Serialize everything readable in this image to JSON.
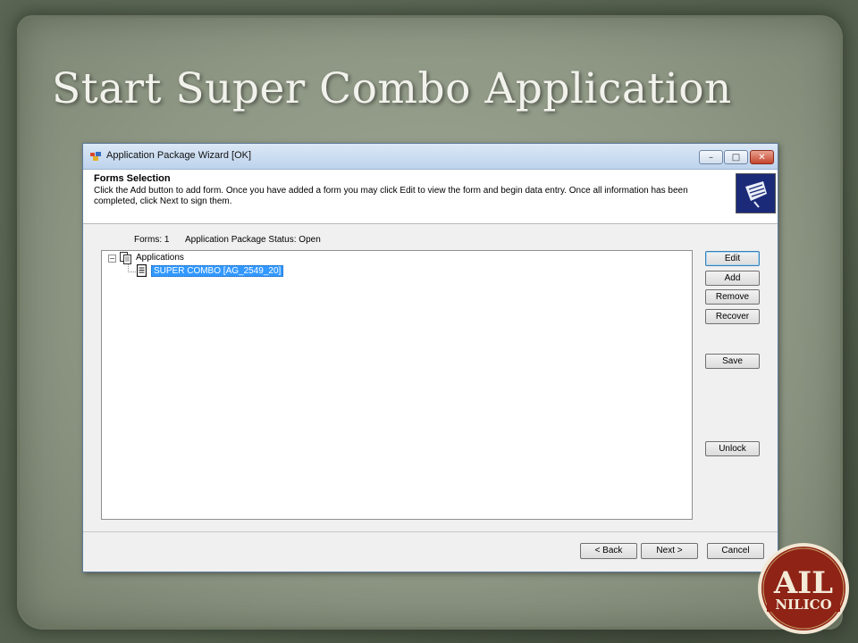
{
  "slide": {
    "title": "Start Super Combo Application",
    "logo_text": "NILICO",
    "logo_monogram": "AIL"
  },
  "window": {
    "title": "Application Package Wizard [OK]",
    "controls": {
      "minimize": "–",
      "maximize": "□",
      "close": "✕"
    }
  },
  "header": {
    "title": "Forms Selection",
    "description": "Click the Add button to add form.  Once you have added a form you may click Edit to view the form and begin data entry.  Once all information has been completed, click Next to sign them."
  },
  "info": {
    "forms_count": "Forms: 1",
    "package_status": "Application Package Status: Open"
  },
  "tree": {
    "expander": "−",
    "root_label": "Applications",
    "child_label": "SUPER COMBO [AG_2549_20]"
  },
  "side_buttons": {
    "edit": "Edit",
    "add": "Add",
    "remove": "Remove",
    "recover": "Recover",
    "save": "Save",
    "unlock": "Unlock"
  },
  "footer_buttons": {
    "back": "< Back",
    "next": "Next >",
    "cancel": "Cancel"
  },
  "colors": {
    "selection": "#3399ff",
    "logo_red": "#8e2316",
    "header_logo_bg": "#1b2a78"
  }
}
